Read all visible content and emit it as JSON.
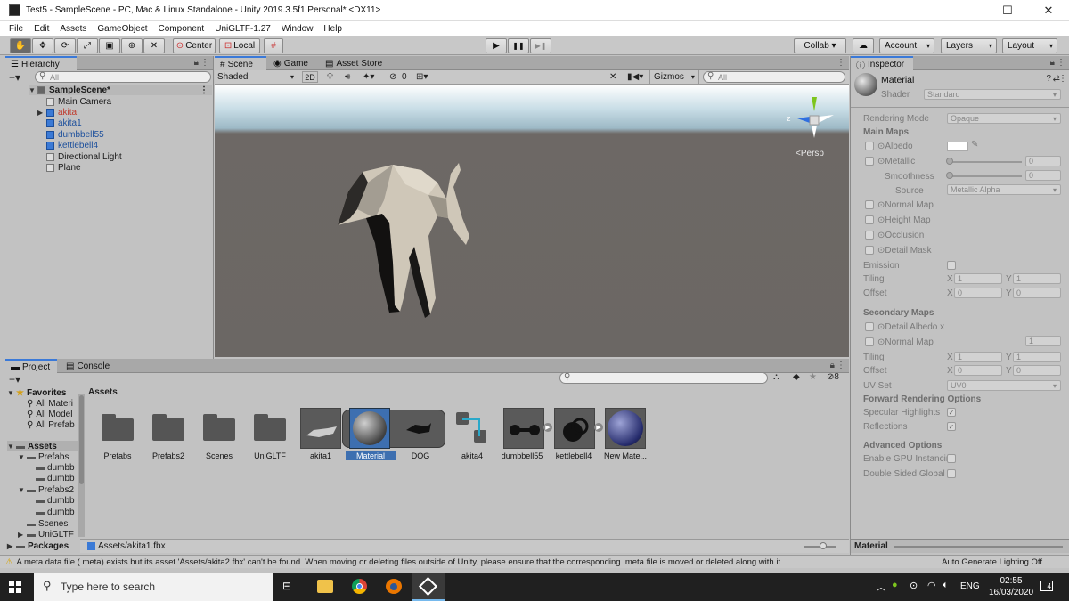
{
  "window": {
    "title": "Test5 - SampleScene - PC, Mac & Linux Standalone - Unity 2019.3.5f1 Personal* <DX11>",
    "min": "—",
    "max": "☐",
    "close": "✕"
  },
  "menu": [
    "File",
    "Edit",
    "Assets",
    "GameObject",
    "Component",
    "UniGLTF-1.27",
    "Window",
    "Help"
  ],
  "toolbar": {
    "center": "Center",
    "local": "Local",
    "collab": "Collab ▾",
    "account": "Account",
    "layers": "Layers",
    "layout": "Layout",
    "play": "▶",
    "pause": "❚❚",
    "step": "▶❚"
  },
  "hierarchy": {
    "tab": "Hierarchy",
    "search": "All",
    "scene": "SampleScene*",
    "items": [
      {
        "name": "Main Camera",
        "color": "#1a1a1a"
      },
      {
        "name": "akita",
        "color": "#c0392b"
      },
      {
        "name": "akita1",
        "color": "#1c4f9c"
      },
      {
        "name": "dumbbell55",
        "color": "#1c4f9c"
      },
      {
        "name": "kettlebell4",
        "color": "#1c4f9c"
      },
      {
        "name": "Directional Light",
        "color": "#1a1a1a"
      },
      {
        "name": "Plane",
        "color": "#1a1a1a"
      }
    ]
  },
  "scene": {
    "tabs": [
      "Scene",
      "Game",
      "Asset Store"
    ],
    "shading": "Shaded",
    "mode2d": "2D",
    "hidden": "0",
    "gizmos": "Gizmos",
    "search": "All",
    "persp": "<Persp",
    "axis_z": "z"
  },
  "project": {
    "tabs": [
      "Project",
      "Console"
    ],
    "hidden": "8",
    "favorites": "Favorites",
    "fav_items": [
      "All Materi",
      "All Model",
      "All Prefab"
    ],
    "assets_root": "Assets",
    "tree": [
      {
        "label": "Prefabs",
        "children": [
          "dumbb",
          "dumbb"
        ]
      },
      {
        "label": "Prefabs2",
        "children": [
          "dumbb",
          "dumbb"
        ]
      },
      {
        "label": "Scenes",
        "children": []
      },
      {
        "label": "UniGLTF",
        "children": []
      }
    ],
    "packages": "Packages",
    "breadcrumb": "Assets",
    "assets": [
      "Prefabs",
      "Prefabs2",
      "Scenes",
      "UniGLTF",
      "akita1",
      "Material",
      "DOG",
      "akita4",
      "dumbbell55",
      "kettlebell4",
      "New Mate..."
    ],
    "path": "Assets/akita1.fbx"
  },
  "inspector": {
    "tab": "Inspector",
    "object": "Material",
    "shader_label": "Shader",
    "shader": "Standard",
    "rendering_mode_label": "Rendering Mode",
    "rendering_mode": "Opaque",
    "main_maps": "Main Maps",
    "albedo": "Albedo",
    "metallic": "Metallic",
    "metallic_val": "0",
    "smoothness": "Smoothness",
    "smoothness_val": "0",
    "source": "Source",
    "source_val": "Metallic Alpha",
    "normal_map": "Normal Map",
    "height_map": "Height Map",
    "occlusion": "Occlusion",
    "detail_mask": "Detail Mask",
    "emission": "Emission",
    "tiling": "Tiling",
    "offset": "Offset",
    "tx": "1",
    "ty": "1",
    "ox": "0",
    "oy": "0",
    "x": "X",
    "y": "Y",
    "secondary": "Secondary Maps",
    "detail_albedo": "Detail Albedo x",
    "normal_map2": "Normal Map",
    "normal2_val": "1",
    "tiling2x": "1",
    "tiling2y": "1",
    "offset2x": "0",
    "offset2y": "0",
    "uvset": "UV Set",
    "uvset_val": "UV0",
    "forward": "Forward Rendering Options",
    "specular": "Specular Highlights",
    "reflections": "Reflections",
    "advanced": "Advanced Options",
    "gpu": "Enable GPU Instancir",
    "double": "Double Sided Global",
    "footer": "Material"
  },
  "status": {
    "message": "A meta data file (.meta) exists but its asset 'Assets/akita2.fbx' can't be found. When moving or deleting files outside of Unity, please ensure that the corresponding .meta file is moved or deleted along with it.",
    "right": "Auto Generate Lighting Off"
  },
  "taskbar": {
    "search": "Type here to search",
    "lang": "ENG",
    "time": "02:55",
    "date": "16/03/2020",
    "notif": "4"
  }
}
